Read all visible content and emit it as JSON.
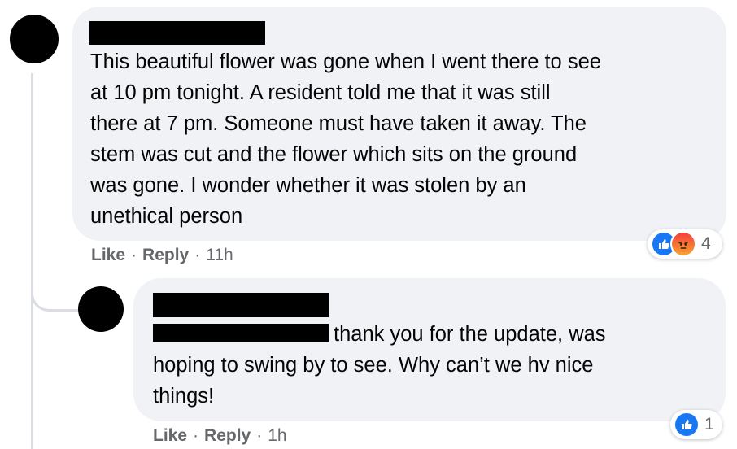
{
  "comment": {
    "author": "",
    "text": "This beautiful flower was gone when I went there to see\nat 10 pm tonight. A resident told me that it was still\nthere at 7 pm. Someone must have taken it away. The\nstem was cut and the flower which sits on the ground\nwas gone. I wonder whether it was stolen by an\nunethical person",
    "like_label": "Like",
    "reply_label": "Reply",
    "separator": "·",
    "time": "11h",
    "reactions": {
      "icons": [
        "like-icon",
        "angry-icon"
      ],
      "count": "4"
    }
  },
  "reply": {
    "author": "",
    "text": "thank you for the update, was",
    "text_rest": "hoping to swing by to see. Why can’t we hv nice\nthings!",
    "like_label": "Like",
    "reply_label": "Reply",
    "separator": "·",
    "time": "1h",
    "reactions": {
      "icons": [
        "like-icon"
      ],
      "count": "1"
    }
  },
  "colors": {
    "bubble": "#f0f2f5",
    "meta_text": "#65676b",
    "like_blue": "#1877f2",
    "thread_line": "#dadde1"
  }
}
